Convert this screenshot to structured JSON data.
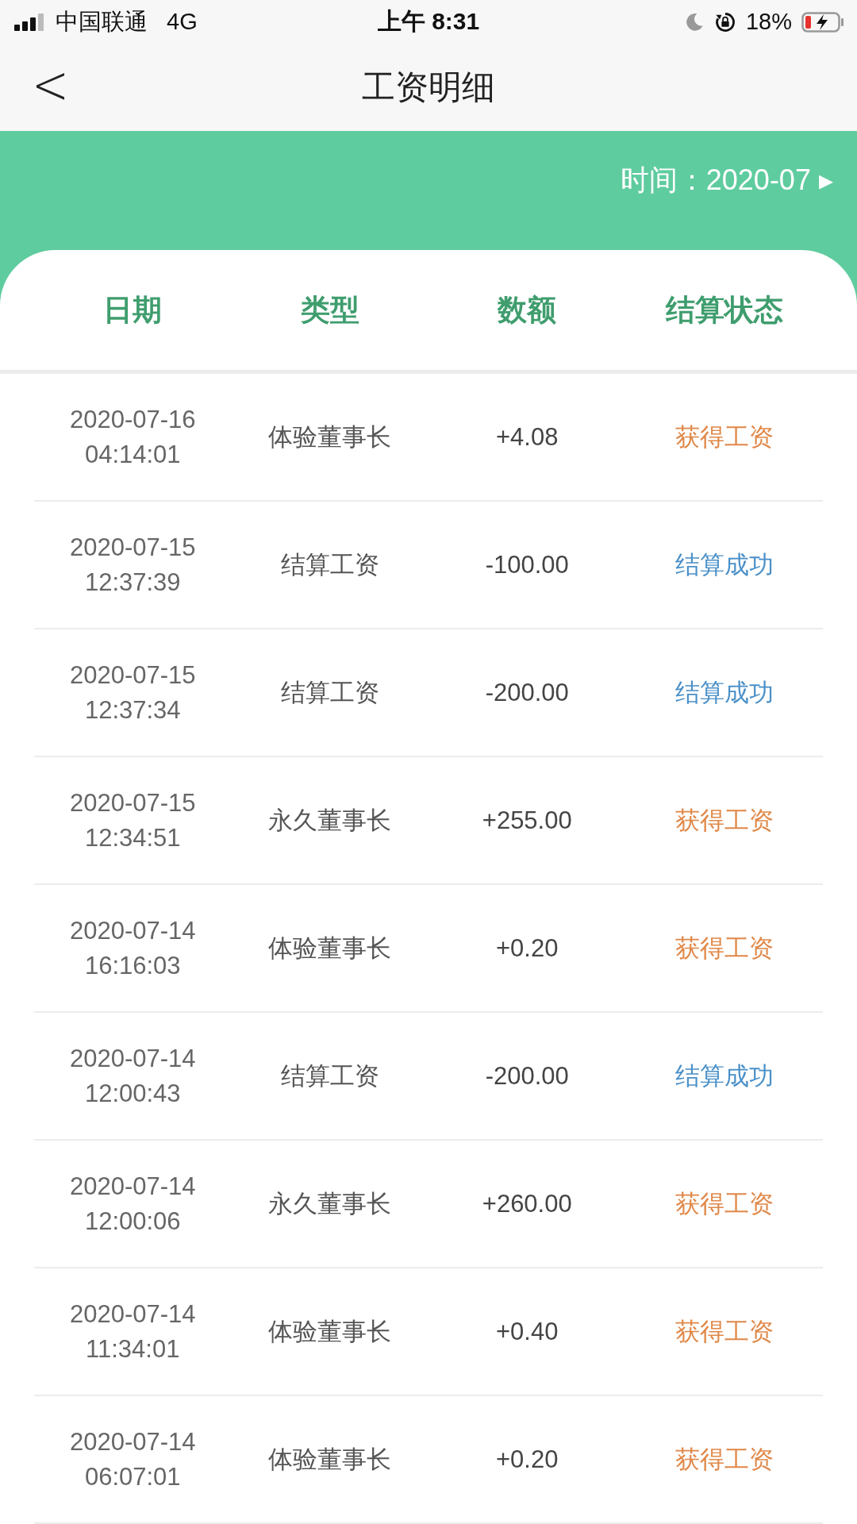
{
  "status_bar": {
    "carrier": "中国联通",
    "network": "4G",
    "time": "上午 8:31",
    "battery": "18%"
  },
  "nav": {
    "back": "<",
    "title": "工资明细"
  },
  "filter": {
    "label": "时间：",
    "value": "2020-07",
    "arrow": "▸"
  },
  "table": {
    "columns": [
      "日期",
      "类型",
      "数额",
      "结算状态"
    ],
    "rows": [
      {
        "date": "2020-07-16",
        "time": "04:14:01",
        "type": "体验董事长",
        "amount": "+4.08",
        "status": "获得工资",
        "kind": "income"
      },
      {
        "date": "2020-07-15",
        "time": "12:37:39",
        "type": "结算工资",
        "amount": "-100.00",
        "status": "结算成功",
        "kind": "settled"
      },
      {
        "date": "2020-07-15",
        "time": "12:37:34",
        "type": "结算工资",
        "amount": "-200.00",
        "status": "结算成功",
        "kind": "settled"
      },
      {
        "date": "2020-07-15",
        "time": "12:34:51",
        "type": "永久董事长",
        "amount": "+255.00",
        "status": "获得工资",
        "kind": "income"
      },
      {
        "date": "2020-07-14",
        "time": "16:16:03",
        "type": "体验董事长",
        "amount": "+0.20",
        "status": "获得工资",
        "kind": "income"
      },
      {
        "date": "2020-07-14",
        "time": "12:00:43",
        "type": "结算工资",
        "amount": "-200.00",
        "status": "结算成功",
        "kind": "settled"
      },
      {
        "date": "2020-07-14",
        "time": "12:00:06",
        "type": "永久董事长",
        "amount": "+260.00",
        "status": "获得工资",
        "kind": "income"
      },
      {
        "date": "2020-07-14",
        "time": "11:34:01",
        "type": "体验董事长",
        "amount": "+0.40",
        "status": "获得工资",
        "kind": "income"
      },
      {
        "date": "2020-07-14",
        "time": "06:07:01",
        "type": "体验董事长",
        "amount": "+0.20",
        "status": "获得工资",
        "kind": "income"
      }
    ]
  }
}
